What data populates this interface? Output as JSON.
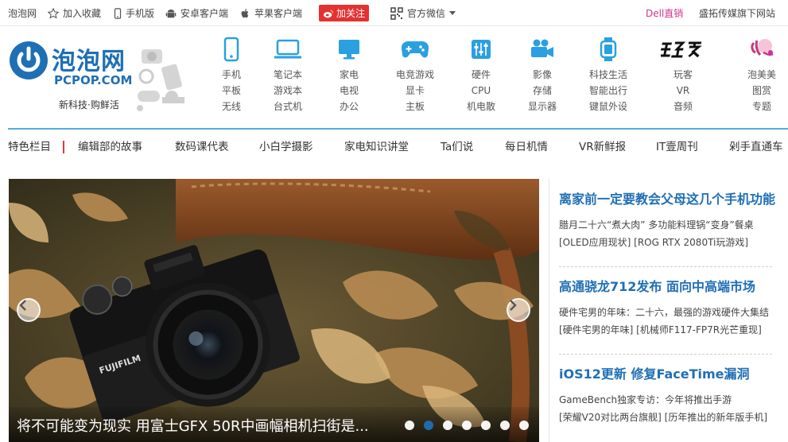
{
  "topbar": {
    "site": "泡泡网",
    "favorite": "加入收藏",
    "mobile": "手机版",
    "android": "安卓客户端",
    "apple": "苹果客户端",
    "weibo": "加关注",
    "wechat": "官方微信",
    "dell": "Dell直销",
    "group": "盛拓传媒旗下网站",
    "colors": {
      "dell": "#d0348e",
      "weibo": "#e43232"
    }
  },
  "logo": {
    "title": "泡泡网",
    "sub": "PCPOP.COM",
    "slogan": "新科技·购鲜活",
    "color": "#1f6fb5"
  },
  "nav": [
    {
      "icon": "phone-icon",
      "lines": [
        "手机",
        "平板",
        "无线"
      ]
    },
    {
      "icon": "laptop-icon",
      "lines": [
        "笔记本",
        "游戏本",
        "台式机"
      ]
    },
    {
      "icon": "monitor-icon",
      "lines": [
        "家电",
        "电视",
        "办公"
      ]
    },
    {
      "icon": "gamepad-icon",
      "lines": [
        "电竞游戏",
        "显卡",
        "主板"
      ]
    },
    {
      "icon": "hardware-icon",
      "lines": [
        "硬件",
        "CPU",
        "机电散"
      ]
    },
    {
      "icon": "video-camera-icon",
      "lines": [
        "影像",
        "存储",
        "显示器"
      ]
    },
    {
      "icon": "watch-icon",
      "lines": [
        "科技生活",
        "智能出行",
        "键鼠外设"
      ]
    },
    {
      "icon": "wanke-logo-icon",
      "lines": [
        "玩客",
        "VR",
        "音频"
      ]
    },
    {
      "icon": "paomeimei-logo-icon",
      "lines": [
        "泡美美",
        "图赏",
        "专题"
      ]
    }
  ],
  "subnav": {
    "featured": "特色栏目",
    "items": [
      "编辑部的故事",
      "数码课代表",
      "小白学摄影",
      "家电知识讲堂",
      "Ta们说",
      "每日机情",
      "VR新鲜报",
      "IT壹周刊",
      "剁手直通车"
    ]
  },
  "slider": {
    "caption": "将不可能变为现实 用富士GFX 50R中画幅相机扫街是...",
    "dots": 7,
    "active": 1,
    "camera_brand": "FUJIFILM"
  },
  "news": [
    {
      "title": "离家前一定要教会父母这几个手机功能",
      "lines": [
        "腊月二十六“煮大肉” 多功能料理锅“变身”餐桌",
        "[OLED应用现状] [ROG RTX 2080Ti玩游戏]"
      ]
    },
    {
      "title": "高通骁龙712发布 面向中高端市场",
      "lines": [
        "硬件宅男的年味：二十六，最强的游戏硬件大集结",
        "[硬件宅男的年味] [机械师F117-FP7R光芒重现]"
      ]
    },
    {
      "title": "iOS12更新 修复FaceTime漏洞",
      "lines": [
        "GameBench独家专访：今年将推出手游",
        "[荣耀V20对比两台旗舰] [历年推出的新年版手机]"
      ]
    }
  ]
}
